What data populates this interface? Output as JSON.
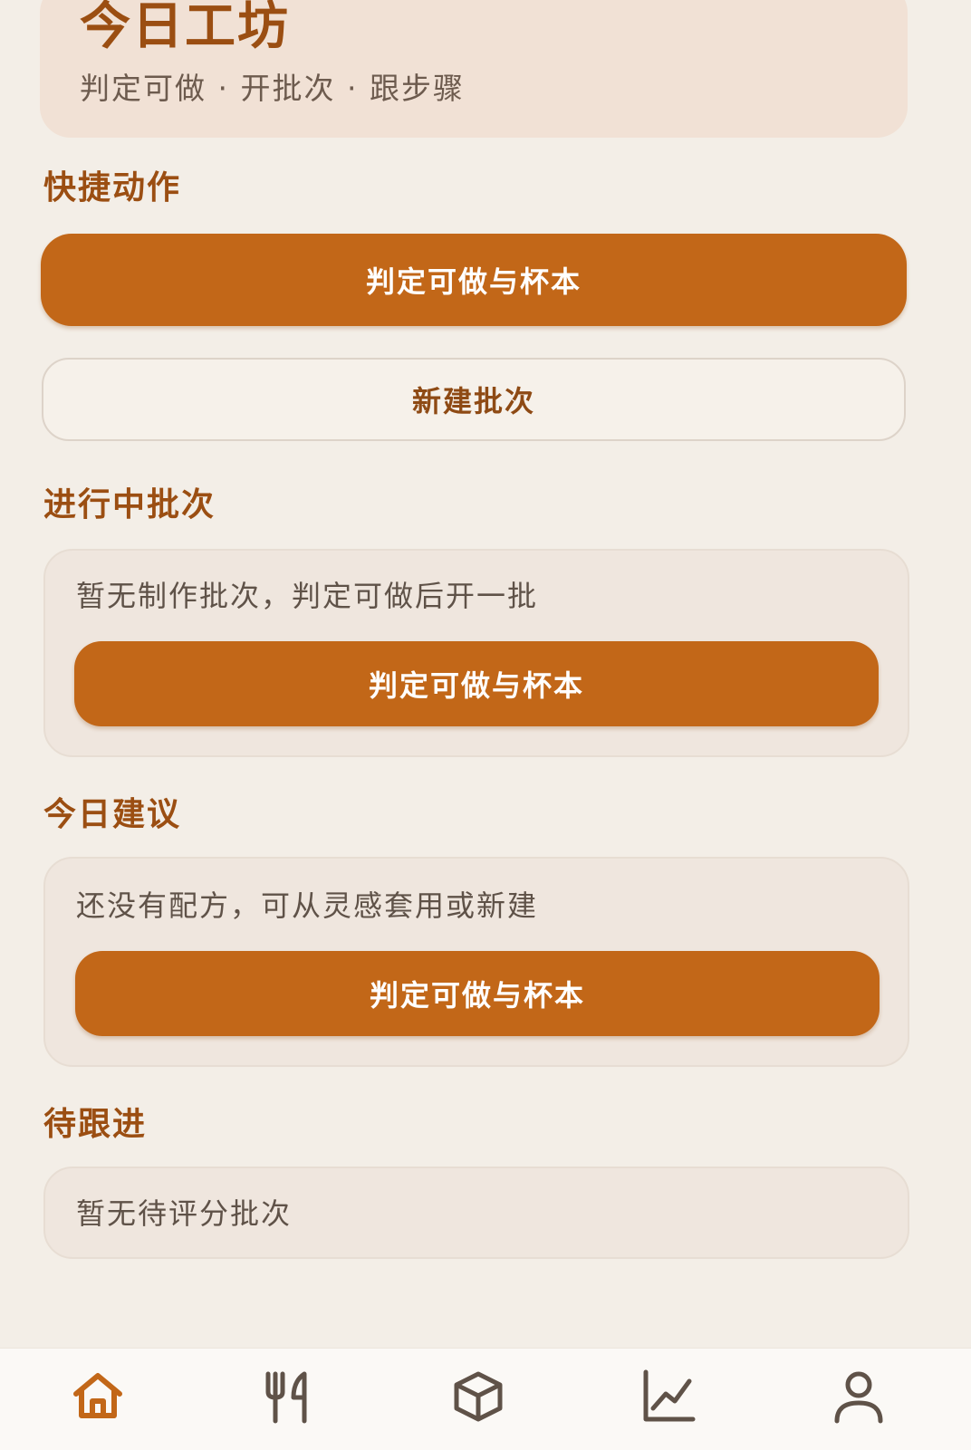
{
  "header": {
    "title": "今日工坊",
    "subtitle": "判定可做 · 开批次 · 跟步骤"
  },
  "quick_actions": {
    "title": "快捷动作",
    "primary_label": "判定可做与杯本",
    "secondary_label": "新建批次"
  },
  "in_progress": {
    "title": "进行中批次",
    "empty_text": "暂无制作批次，判定可做后开一批",
    "button_label": "判定可做与杯本"
  },
  "suggestions": {
    "title": "今日建议",
    "empty_text": "还没有配方，可从灵感套用或新建",
    "button_label": "判定可做与杯本"
  },
  "follow_up": {
    "title": "待跟进",
    "empty_text": "暂无待评分批次"
  },
  "bottom_nav": {
    "items": [
      {
        "icon": "home-icon",
        "active": true
      },
      {
        "icon": "utensils-icon",
        "active": false
      },
      {
        "icon": "box-icon",
        "active": false
      },
      {
        "icon": "chart-icon",
        "active": false
      },
      {
        "icon": "user-icon",
        "active": false
      }
    ]
  },
  "colors": {
    "accent": "#C26718",
    "accent_text": "#9B4E12",
    "background": "#F3EEE7",
    "card": "#EFE6DE",
    "hero": "#F1E1D5",
    "nav_inactive": "#5F5248"
  }
}
